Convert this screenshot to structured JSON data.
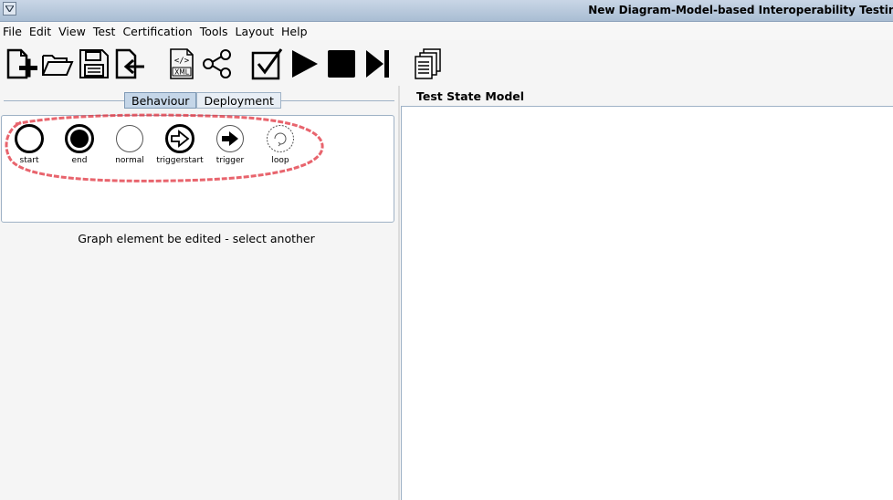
{
  "window": {
    "title": "New Diagram-Model-based Interoperability Testing"
  },
  "menu": [
    "File",
    "Edit",
    "View",
    "Test",
    "Certification",
    "Tools",
    "Layout",
    "Help"
  ],
  "toolbar": {
    "icons": [
      "new-file-icon",
      "open-folder-icon",
      "save-icon",
      "import-icon",
      "xml-icon",
      "share-icon",
      "check-icon",
      "play-icon",
      "stop-icon",
      "skip-forward-icon",
      "documents-icon"
    ],
    "xml_label": "XML"
  },
  "left": {
    "tabs": [
      "Behaviour",
      "Deployment"
    ],
    "active_tab": "Behaviour",
    "palette": [
      {
        "label": "start"
      },
      {
        "label": "end"
      },
      {
        "label": "normal"
      },
      {
        "label": "triggerstart"
      },
      {
        "label": "trigger"
      },
      {
        "label": "loop"
      }
    ],
    "status": "Graph element be edited - select another"
  },
  "right": {
    "title": "Test State Model"
  }
}
